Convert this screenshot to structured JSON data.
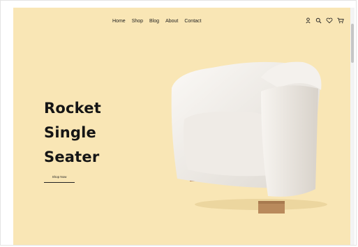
{
  "nav": {
    "links": [
      "Home",
      "Shop",
      "Blog",
      "About",
      "Contact"
    ],
    "icons": [
      "user-icon",
      "search-icon",
      "heart-icon",
      "cart-icon"
    ]
  },
  "hero": {
    "title_lines": [
      "Rocket",
      "Single",
      "Seater"
    ],
    "cta_label": "Shop Now"
  },
  "colors": {
    "background": "#f9e6b5",
    "text": "#151515",
    "chair": "#f1eeea",
    "legs": "#b98a5c"
  }
}
